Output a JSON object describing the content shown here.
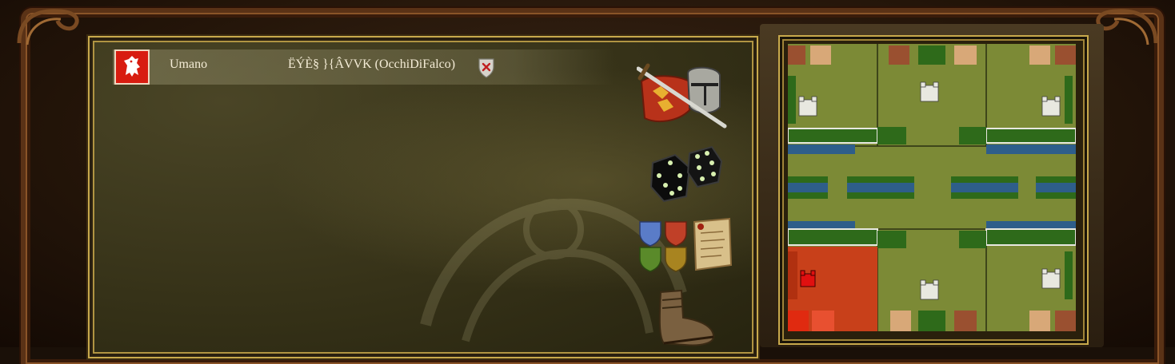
{
  "player": {
    "type_label": "Umano",
    "name": "ËÝÈ§ }{ÂVVK (OcchiDiFalco)",
    "crest_color": "#d81c10"
  },
  "icons": {
    "crest": "red-lion-crest-icon",
    "kick": "shield-x-icon",
    "combat": "sword-helmet-shield-icon",
    "dice": "dice-icon",
    "teams": "team-shields-scroll-icon",
    "boot": "boot-icon"
  },
  "map": {
    "player_start_color": "#c8401a",
    "terrain_color": "#7c8a36",
    "water_color": "#2e5e8a"
  }
}
